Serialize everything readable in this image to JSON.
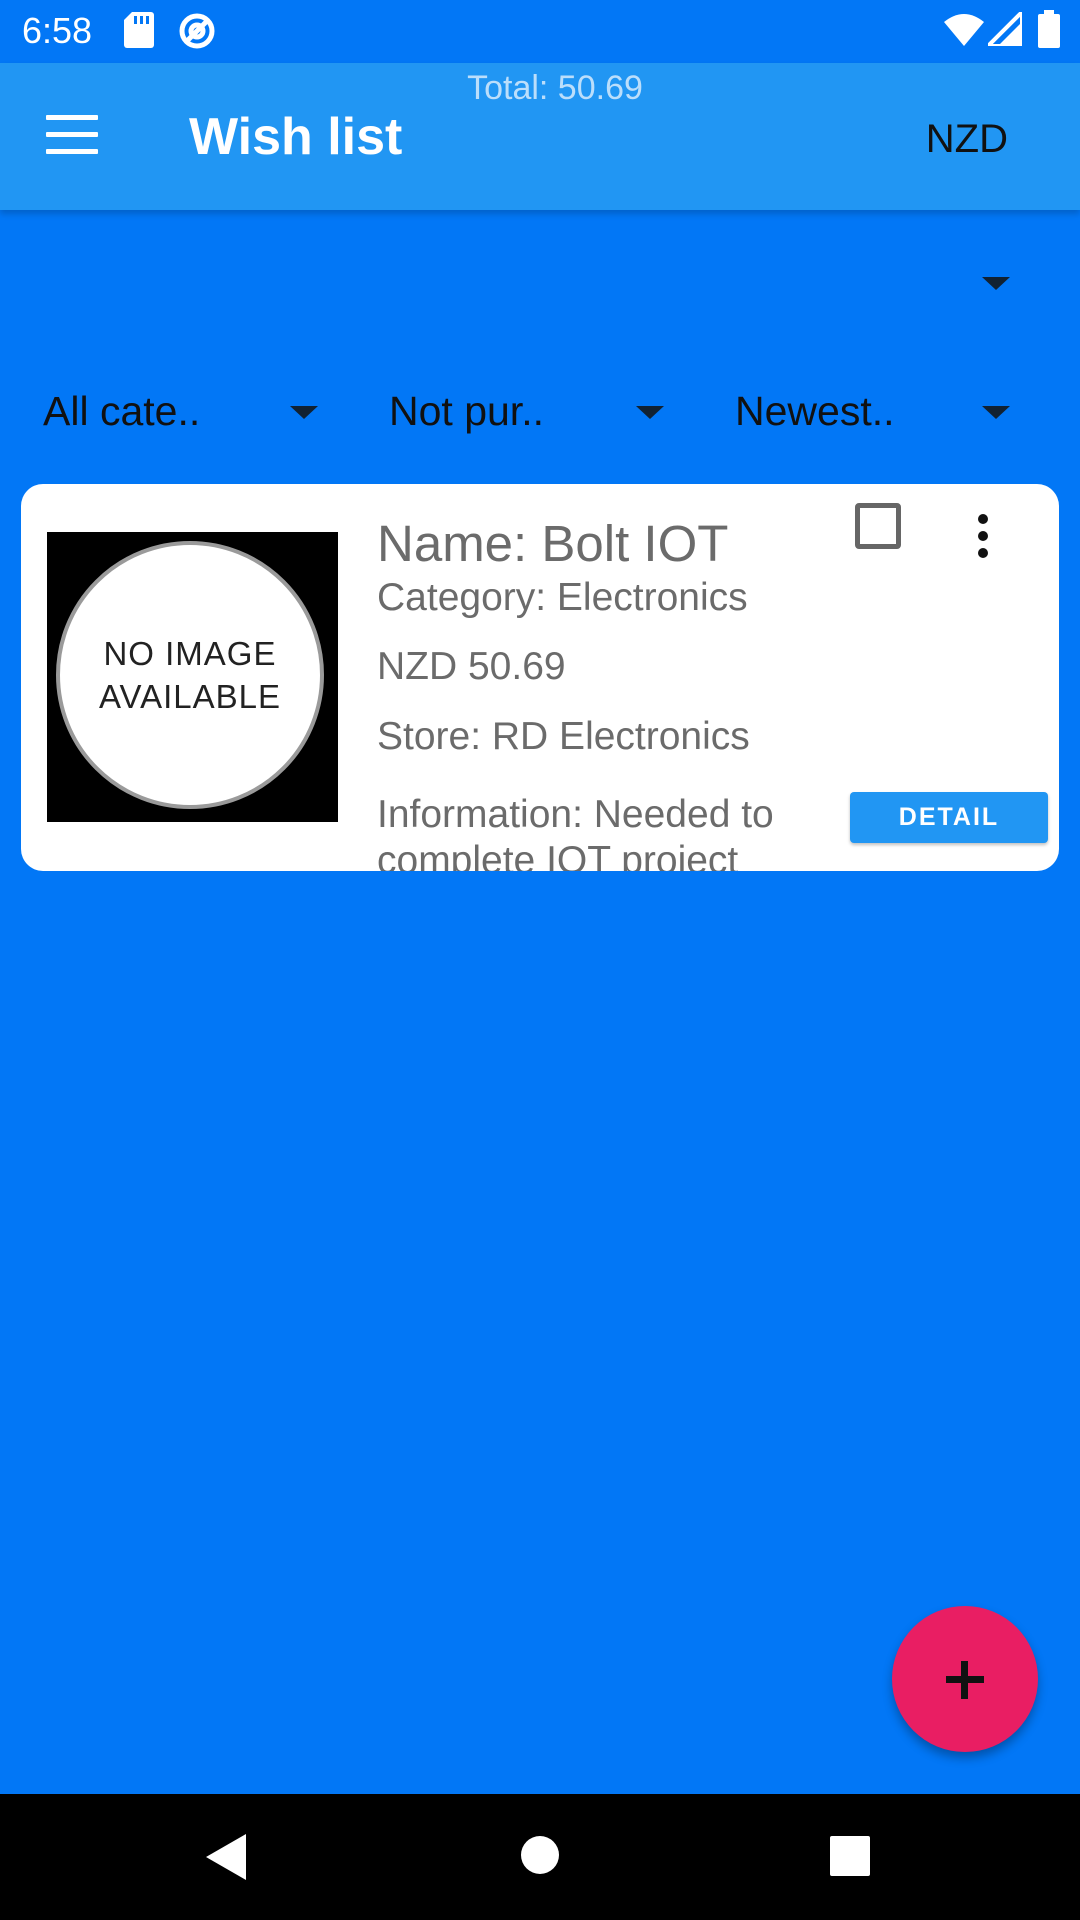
{
  "status_bar": {
    "time": "6:58",
    "icons": [
      "sd-card-icon",
      "at-sign-icon",
      "wifi-icon",
      "signal-icon",
      "battery-icon"
    ]
  },
  "app_bar": {
    "total": "Total: 50.69",
    "title": "Wish list",
    "currency": "NZD",
    "menu_icon": "hamburger-menu-icon"
  },
  "filters": {
    "category": "All cate..",
    "purchase_status": "Not pur..",
    "sort": "Newest.."
  },
  "items": [
    {
      "image_text_line1": "NO IMAGE",
      "image_text_line2": "AVAILABLE",
      "name": "Name: Bolt IOT",
      "category": "Category: Electronics",
      "price": "NZD 50.69",
      "store": "Store: RD Electronics",
      "information": "Information: Needed to complete IOT project",
      "detail_label": "DETAIL"
    }
  ],
  "colors": {
    "background": "#0277F6",
    "app_bar": "#2196F3",
    "fab": "#E91E63",
    "detail_button": "#2196F3"
  },
  "nav_icons": [
    "back-icon",
    "home-icon",
    "recents-icon"
  ]
}
